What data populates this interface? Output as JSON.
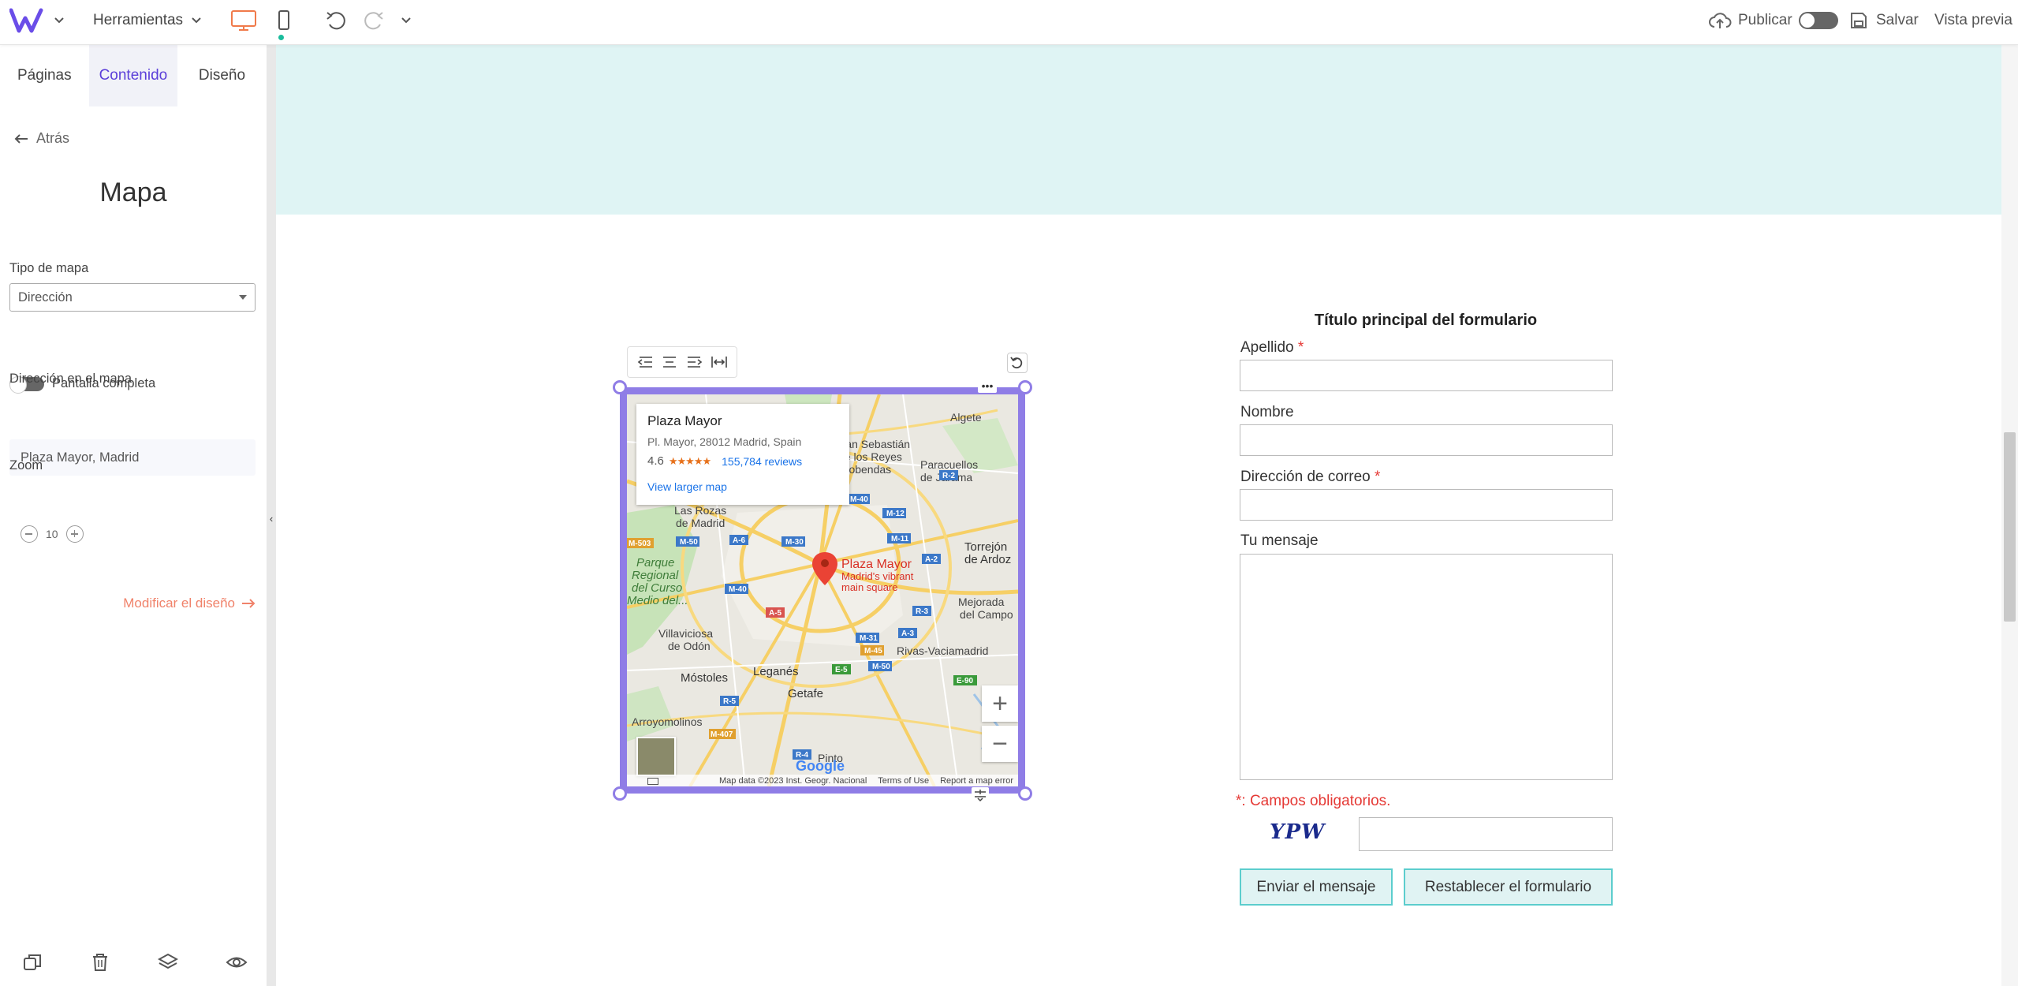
{
  "topbar": {
    "tools_label": "Herramientas",
    "publish_label": "Publicar",
    "save_label": "Salvar",
    "preview_label": "Vista previa"
  },
  "panel": {
    "tabs": [
      "Páginas",
      "Contenido",
      "Diseño"
    ],
    "active_tab": "Contenido",
    "back_label": "Atrás",
    "title": "Mapa",
    "map_type_label": "Tipo de mapa",
    "map_type_value": "Dirección",
    "fullscreen_label": "Pantalla completa",
    "address_label": "Dirección en el mapa",
    "address_value": "Plaza Mayor, Madrid",
    "zoom_label": "Zoom",
    "zoom_value": "10",
    "modify_label": "Modificar el diseño"
  },
  "map": {
    "place_title": "Plaza Mayor",
    "place_address": "Pl. Mayor, 28012 Madrid, Spain",
    "rating": "4.6",
    "stars": "★★★★★",
    "reviews": "155,784 reviews",
    "larger_map": "View larger map",
    "pin_title": "Plaza Mayor",
    "pin_sub1": "Madrid's vibrant",
    "pin_sub2": "main square",
    "footer_data": "Map data ©2023 Inst. Geogr. Nacional",
    "footer_terms": "Terms of Use",
    "footer_report": "Report a map error",
    "google": "Google",
    "places": {
      "algete": "Algete",
      "san_sebastian": "San Sebastián",
      "de_los_reyes": "de los Reyes",
      "alcobendas": "Alcobendas",
      "paracuellos": "Paracuellos",
      "de_jarama": "de Jarama",
      "las_rozas": "Las Rozas",
      "de_madrid": "de Madrid",
      "torrejon": "Torrejón",
      "de_ardoz": "de Ardoz",
      "parque1": "Parque",
      "parque2": "Regional",
      "parque3": "del Curso",
      "parque4": "Medio del...",
      "mejorada": "Mejorada",
      "del_campo": "del Campo",
      "villaviciosa": "Villaviciosa",
      "de_odon": "de Odón",
      "rivas": "Rivas-Vaciamadrid",
      "mostoles": "Móstoles",
      "leganes": "Leganés",
      "getafe": "Getafe",
      "arroyomolinos": "Arroyomolinos",
      "pinto": "Pinto"
    },
    "roads": {
      "m40a": "M-40",
      "r2": "R-2",
      "m12": "M-12",
      "m50a": "M-50",
      "a6": "A-6",
      "m30": "M-30",
      "m11": "M-11",
      "a2": "A-2",
      "m503": "M-503",
      "m40b": "M-40",
      "a5": "A-5",
      "r3": "R-3",
      "m31": "M-31",
      "a3": "A-3",
      "m45": "M-45",
      "e5": "E-5",
      "m50b": "M-50",
      "e90": "E-90",
      "r5": "R-5",
      "m407": "M-407",
      "r4": "R-4"
    }
  },
  "form": {
    "title": "Título principal del formulario",
    "field_lastname": "Apellido",
    "field_name": "Nombre",
    "field_email": "Dirección de correo",
    "field_message": "Tu mensaje",
    "required_mark": "*",
    "required_note": "*: Campos obligatorios.",
    "captcha": "YPW",
    "submit_label": "Enviar el mensaje",
    "reset_label": "Restablecer el formulario"
  },
  "colors": {
    "accent": "#5b3fd9",
    "selection": "#8f7de6",
    "banner": "#dff4f4",
    "button_border": "#5ccdcd",
    "required": "#e53935",
    "modify_link": "#f0826a"
  }
}
